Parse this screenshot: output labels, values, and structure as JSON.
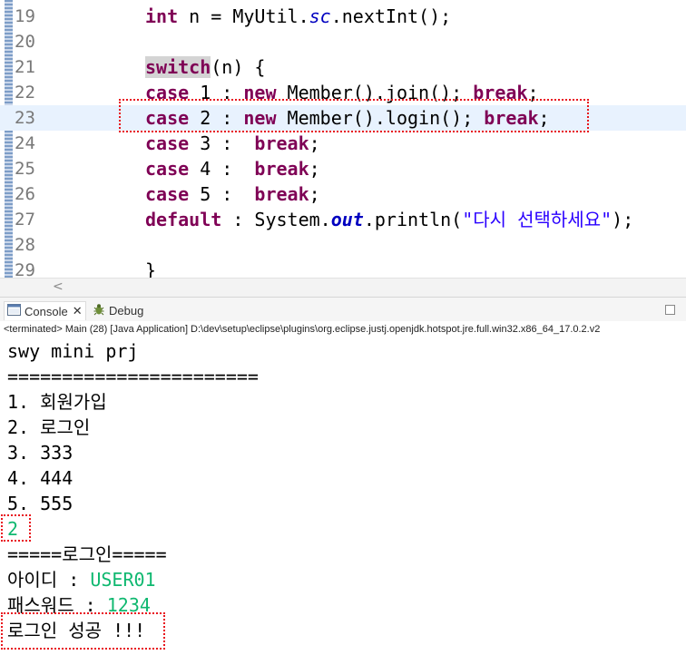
{
  "editor": {
    "lines": [
      {
        "num": "19",
        "parts": [
          {
            "t": "int",
            "c": "kw"
          },
          {
            "t": " n = MyUtil."
          },
          {
            "t": "sc",
            "c": "fld"
          },
          {
            "t": ".nextInt();"
          }
        ]
      },
      {
        "num": "20",
        "parts": []
      },
      {
        "num": "21",
        "parts": [
          {
            "t": "switch",
            "c": "kw-sw"
          },
          {
            "t": "(n) {"
          }
        ]
      },
      {
        "num": "22",
        "parts": [
          {
            "t": "case",
            "c": "kw"
          },
          {
            "t": " 1 : "
          },
          {
            "t": "new",
            "c": "kw"
          },
          {
            "t": " Member().join(); "
          },
          {
            "t": "break",
            "c": "kw"
          },
          {
            "t": ";"
          }
        ]
      },
      {
        "num": "23",
        "current": true,
        "parts": [
          {
            "t": "case",
            "c": "kw"
          },
          {
            "t": " 2 : "
          },
          {
            "t": "new",
            "c": "kw"
          },
          {
            "t": " Member().login(); "
          },
          {
            "t": "break",
            "c": "kw"
          },
          {
            "t": ";"
          }
        ]
      },
      {
        "num": "24",
        "parts": [
          {
            "t": "case",
            "c": "kw"
          },
          {
            "t": " 3 :  "
          },
          {
            "t": "break",
            "c": "kw"
          },
          {
            "t": ";"
          }
        ]
      },
      {
        "num": "25",
        "parts": [
          {
            "t": "case",
            "c": "kw"
          },
          {
            "t": " 4 :  "
          },
          {
            "t": "break",
            "c": "kw"
          },
          {
            "t": ";"
          }
        ]
      },
      {
        "num": "26",
        "parts": [
          {
            "t": "case",
            "c": "kw"
          },
          {
            "t": " 5 :  "
          },
          {
            "t": "break",
            "c": "kw"
          },
          {
            "t": ";"
          }
        ]
      },
      {
        "num": "27",
        "parts": [
          {
            "t": "default",
            "c": "kw"
          },
          {
            "t": " : System."
          },
          {
            "t": "out",
            "c": "fldb"
          },
          {
            "t": ".println("
          },
          {
            "t": "\"다시 선택하세요\"",
            "c": "str"
          },
          {
            "t": ");"
          }
        ]
      },
      {
        "num": "28",
        "parts": []
      },
      {
        "num": "29",
        "parts": [
          {
            "t": "}"
          }
        ]
      }
    ]
  },
  "scrollbar": {
    "left_arrow": "<"
  },
  "views": {
    "console_tab": "Console",
    "console_close": "✕",
    "debug_tab": "Debug"
  },
  "status_line": "<terminated> Main (28) [Java Application] D:\\dev\\setup\\eclipse\\plugins\\org.eclipse.justj.openjdk.hotspot.jre.full.win32.x86_64_17.0.2.v2",
  "console": {
    "lines": [
      {
        "text": "swy mini prj"
      },
      {
        "text": "======================="
      },
      {
        "text": "1. 회원가입"
      },
      {
        "text": "2. 로그인"
      },
      {
        "text": "3. 333"
      },
      {
        "text": "4. 444"
      },
      {
        "text": "5. 555"
      },
      {
        "text": "2",
        "input": true
      },
      {
        "text": "=====로그인====="
      },
      {
        "label": "아이디 : ",
        "input_value": "USER01"
      },
      {
        "label": "패스워드 : ",
        "input_value": "1234"
      },
      {
        "text": "로그인 성공 !!!"
      }
    ]
  },
  "colors": {
    "keyword": "#7f0055",
    "string": "#2a00ff",
    "field": "#0000c0",
    "console_input": "#0fb870",
    "annotation_box": "#e8141c",
    "current_line": "#e8f2fe"
  }
}
